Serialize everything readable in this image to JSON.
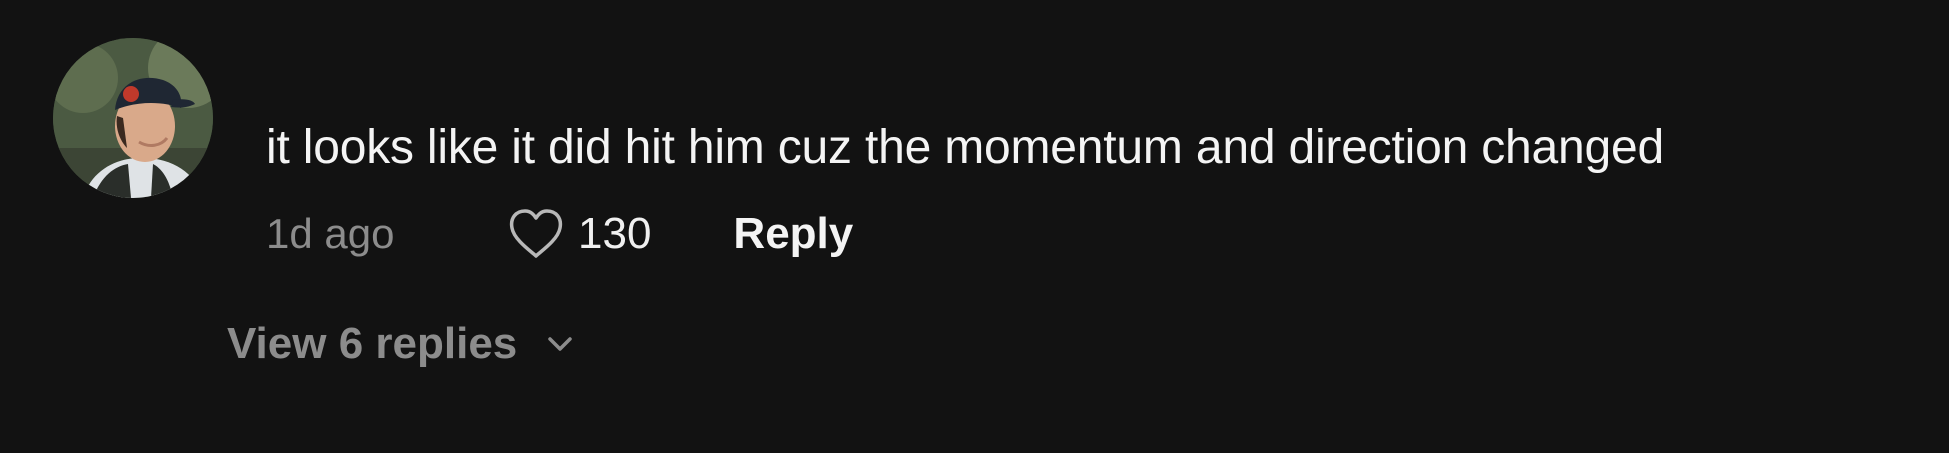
{
  "comment": {
    "text": "it looks like it did hit him cuz the momentum and direction changed",
    "time": "1d ago",
    "likes": "130",
    "reply_label": "Reply",
    "view_replies_label": "View 6 replies",
    "avatar_icon": "user-avatar",
    "like_icon": "heart-icon",
    "expand_icon": "chevron-down-icon"
  },
  "colors": {
    "background": "#121212",
    "primary_text": "#f4f4f4",
    "secondary_text": "#8c8c8c"
  }
}
